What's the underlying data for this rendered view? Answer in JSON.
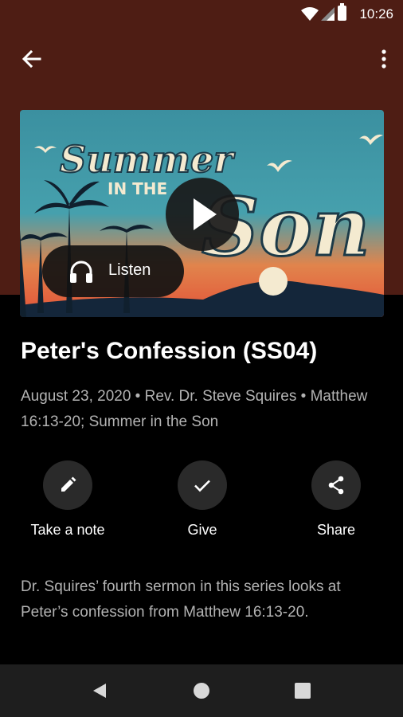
{
  "status_bar": {
    "time": "10:26"
  },
  "artwork": {
    "line1": "Summer",
    "line2": "IN THE",
    "line3": "Son"
  },
  "player": {
    "listen_label": "Listen"
  },
  "sermon": {
    "title": "Peter's Confession (SS04)",
    "meta": "August 23, 2020 • Rev. Dr. Steve Squires • Matthew 16:13-20; Summer in the Son",
    "description": "Dr. Squires’ fourth sermon in this series looks at Peter’s confession from Matthew 16:13-20."
  },
  "actions": [
    {
      "label": "Take a note",
      "icon": "pencil-icon"
    },
    {
      "label": "Give",
      "icon": "check-icon"
    },
    {
      "label": "Share",
      "icon": "share-icon"
    }
  ],
  "colors": {
    "header": "#4e1d14",
    "background": "#000000",
    "action_circle": "#2a2a2a",
    "secondary_text": "#b3b3b3"
  }
}
